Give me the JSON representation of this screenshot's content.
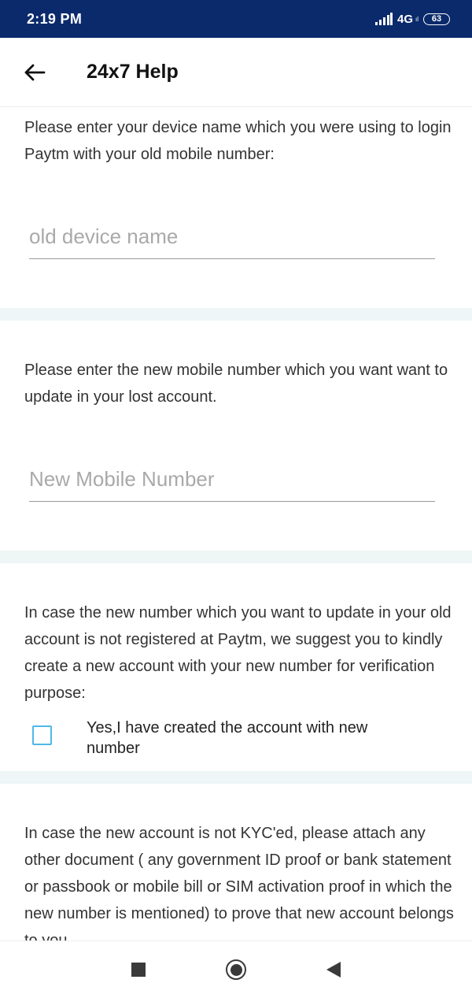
{
  "status_bar": {
    "time": "2:19 PM",
    "network": "4G",
    "network_sub": "ıl",
    "battery": "63",
    "icons": [
      "signal-icon",
      "battery-icon"
    ]
  },
  "app_bar": {
    "title": "24x7 Help",
    "back_icon": "arrow-left-icon"
  },
  "sections": {
    "old_device": {
      "prompt": "Please enter your device name which you were using to login Paytm with your old mobile number:",
      "input_placeholder": "old device name",
      "input_value": ""
    },
    "new_number": {
      "prompt": "Please enter the new mobile number which you want want to update in your lost account.",
      "input_placeholder": "New Mobile Number",
      "input_value": ""
    },
    "create_account": {
      "prompt": "In case the new number which you want to update in your old account is not registered at Paytm, we suggest you to kindly create a new account with your new number for verification purpose:",
      "checkbox_label": "Yes,I have created the account with new number",
      "checked": false
    },
    "kyc": {
      "prompt": "In case the new account is not KYC'ed, please attach any other document ( any government ID proof or bank statement or passbook or mobile bill or SIM activation proof in which the new number is mentioned) to prove that new account belongs to you."
    }
  },
  "nav_bar": {
    "icons": [
      "recents-square-icon",
      "home-circle-icon",
      "back-triangle-icon"
    ]
  },
  "colors": {
    "status_bar_bg": "#0a2a6b",
    "checkbox_border": "#4fb8e8",
    "section_gap": "#eef6f6"
  }
}
